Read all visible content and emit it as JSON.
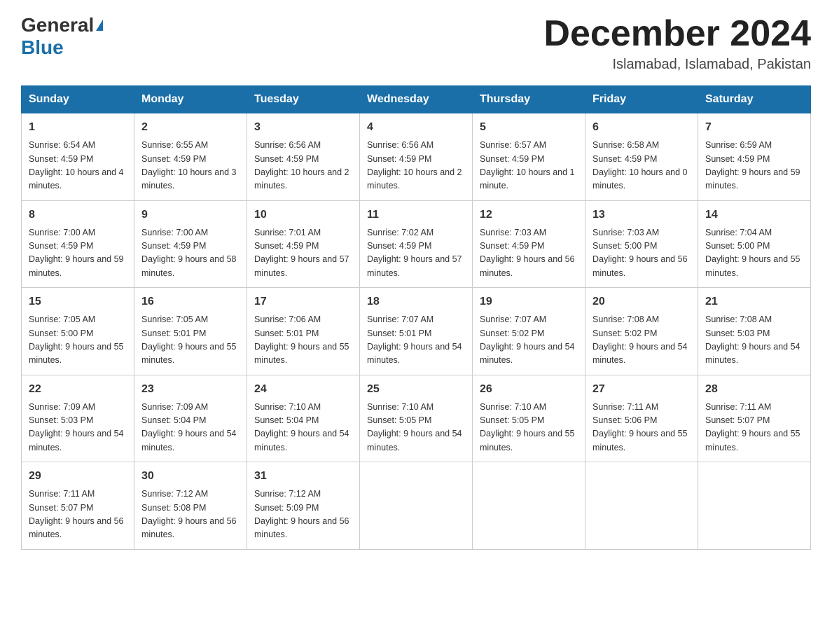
{
  "header": {
    "logo_general": "General",
    "logo_blue": "Blue",
    "month_title": "December 2024",
    "location": "Islamabad, Islamabad, Pakistan"
  },
  "days_of_week": [
    "Sunday",
    "Monday",
    "Tuesday",
    "Wednesday",
    "Thursday",
    "Friday",
    "Saturday"
  ],
  "weeks": [
    [
      {
        "day": "1",
        "sunrise": "6:54 AM",
        "sunset": "4:59 PM",
        "daylight": "10 hours and 4 minutes."
      },
      {
        "day": "2",
        "sunrise": "6:55 AM",
        "sunset": "4:59 PM",
        "daylight": "10 hours and 3 minutes."
      },
      {
        "day": "3",
        "sunrise": "6:56 AM",
        "sunset": "4:59 PM",
        "daylight": "10 hours and 2 minutes."
      },
      {
        "day": "4",
        "sunrise": "6:56 AM",
        "sunset": "4:59 PM",
        "daylight": "10 hours and 2 minutes."
      },
      {
        "day": "5",
        "sunrise": "6:57 AM",
        "sunset": "4:59 PM",
        "daylight": "10 hours and 1 minute."
      },
      {
        "day": "6",
        "sunrise": "6:58 AM",
        "sunset": "4:59 PM",
        "daylight": "10 hours and 0 minutes."
      },
      {
        "day": "7",
        "sunrise": "6:59 AM",
        "sunset": "4:59 PM",
        "daylight": "9 hours and 59 minutes."
      }
    ],
    [
      {
        "day": "8",
        "sunrise": "7:00 AM",
        "sunset": "4:59 PM",
        "daylight": "9 hours and 59 minutes."
      },
      {
        "day": "9",
        "sunrise": "7:00 AM",
        "sunset": "4:59 PM",
        "daylight": "9 hours and 58 minutes."
      },
      {
        "day": "10",
        "sunrise": "7:01 AM",
        "sunset": "4:59 PM",
        "daylight": "9 hours and 57 minutes."
      },
      {
        "day": "11",
        "sunrise": "7:02 AM",
        "sunset": "4:59 PM",
        "daylight": "9 hours and 57 minutes."
      },
      {
        "day": "12",
        "sunrise": "7:03 AM",
        "sunset": "4:59 PM",
        "daylight": "9 hours and 56 minutes."
      },
      {
        "day": "13",
        "sunrise": "7:03 AM",
        "sunset": "5:00 PM",
        "daylight": "9 hours and 56 minutes."
      },
      {
        "day": "14",
        "sunrise": "7:04 AM",
        "sunset": "5:00 PM",
        "daylight": "9 hours and 55 minutes."
      }
    ],
    [
      {
        "day": "15",
        "sunrise": "7:05 AM",
        "sunset": "5:00 PM",
        "daylight": "9 hours and 55 minutes."
      },
      {
        "day": "16",
        "sunrise": "7:05 AM",
        "sunset": "5:01 PM",
        "daylight": "9 hours and 55 minutes."
      },
      {
        "day": "17",
        "sunrise": "7:06 AM",
        "sunset": "5:01 PM",
        "daylight": "9 hours and 55 minutes."
      },
      {
        "day": "18",
        "sunrise": "7:07 AM",
        "sunset": "5:01 PM",
        "daylight": "9 hours and 54 minutes."
      },
      {
        "day": "19",
        "sunrise": "7:07 AM",
        "sunset": "5:02 PM",
        "daylight": "9 hours and 54 minutes."
      },
      {
        "day": "20",
        "sunrise": "7:08 AM",
        "sunset": "5:02 PM",
        "daylight": "9 hours and 54 minutes."
      },
      {
        "day": "21",
        "sunrise": "7:08 AM",
        "sunset": "5:03 PM",
        "daylight": "9 hours and 54 minutes."
      }
    ],
    [
      {
        "day": "22",
        "sunrise": "7:09 AM",
        "sunset": "5:03 PM",
        "daylight": "9 hours and 54 minutes."
      },
      {
        "day": "23",
        "sunrise": "7:09 AM",
        "sunset": "5:04 PM",
        "daylight": "9 hours and 54 minutes."
      },
      {
        "day": "24",
        "sunrise": "7:10 AM",
        "sunset": "5:04 PM",
        "daylight": "9 hours and 54 minutes."
      },
      {
        "day": "25",
        "sunrise": "7:10 AM",
        "sunset": "5:05 PM",
        "daylight": "9 hours and 54 minutes."
      },
      {
        "day": "26",
        "sunrise": "7:10 AM",
        "sunset": "5:05 PM",
        "daylight": "9 hours and 55 minutes."
      },
      {
        "day": "27",
        "sunrise": "7:11 AM",
        "sunset": "5:06 PM",
        "daylight": "9 hours and 55 minutes."
      },
      {
        "day": "28",
        "sunrise": "7:11 AM",
        "sunset": "5:07 PM",
        "daylight": "9 hours and 55 minutes."
      }
    ],
    [
      {
        "day": "29",
        "sunrise": "7:11 AM",
        "sunset": "5:07 PM",
        "daylight": "9 hours and 56 minutes."
      },
      {
        "day": "30",
        "sunrise": "7:12 AM",
        "sunset": "5:08 PM",
        "daylight": "9 hours and 56 minutes."
      },
      {
        "day": "31",
        "sunrise": "7:12 AM",
        "sunset": "5:09 PM",
        "daylight": "9 hours and 56 minutes."
      },
      null,
      null,
      null,
      null
    ]
  ]
}
